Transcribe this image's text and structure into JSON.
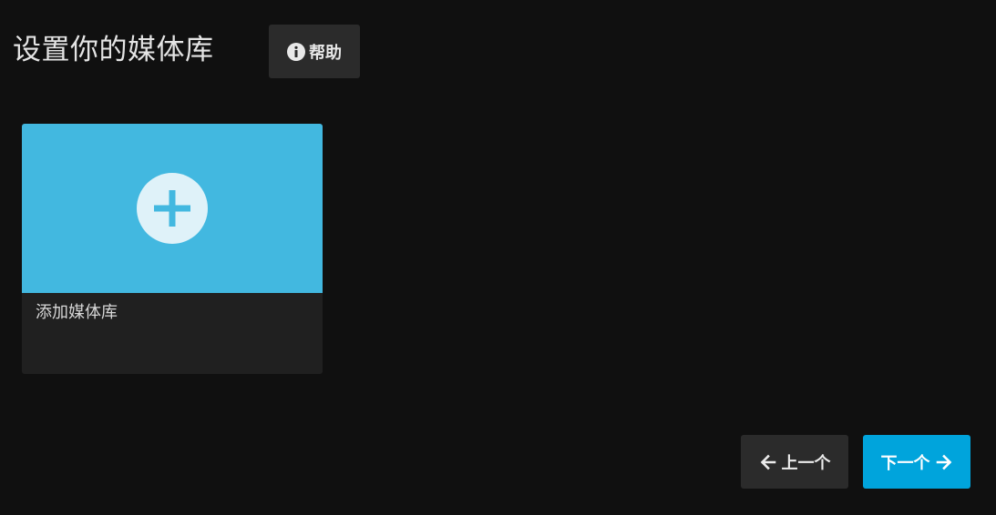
{
  "header": {
    "title": "设置你的媒体库",
    "help_label": "帮助"
  },
  "library_card": {
    "label": "添加媒体库"
  },
  "footer": {
    "prev_label": "上一个",
    "next_label": "下一个"
  },
  "colors": {
    "background": "#101010",
    "card_accent": "#42b8e0",
    "primary_button": "#00a4dc",
    "secondary_button": "#2b2b2b"
  },
  "icons": {
    "help": "info-icon",
    "add": "plus-icon",
    "prev": "arrow-left-icon",
    "next": "arrow-right-icon"
  }
}
